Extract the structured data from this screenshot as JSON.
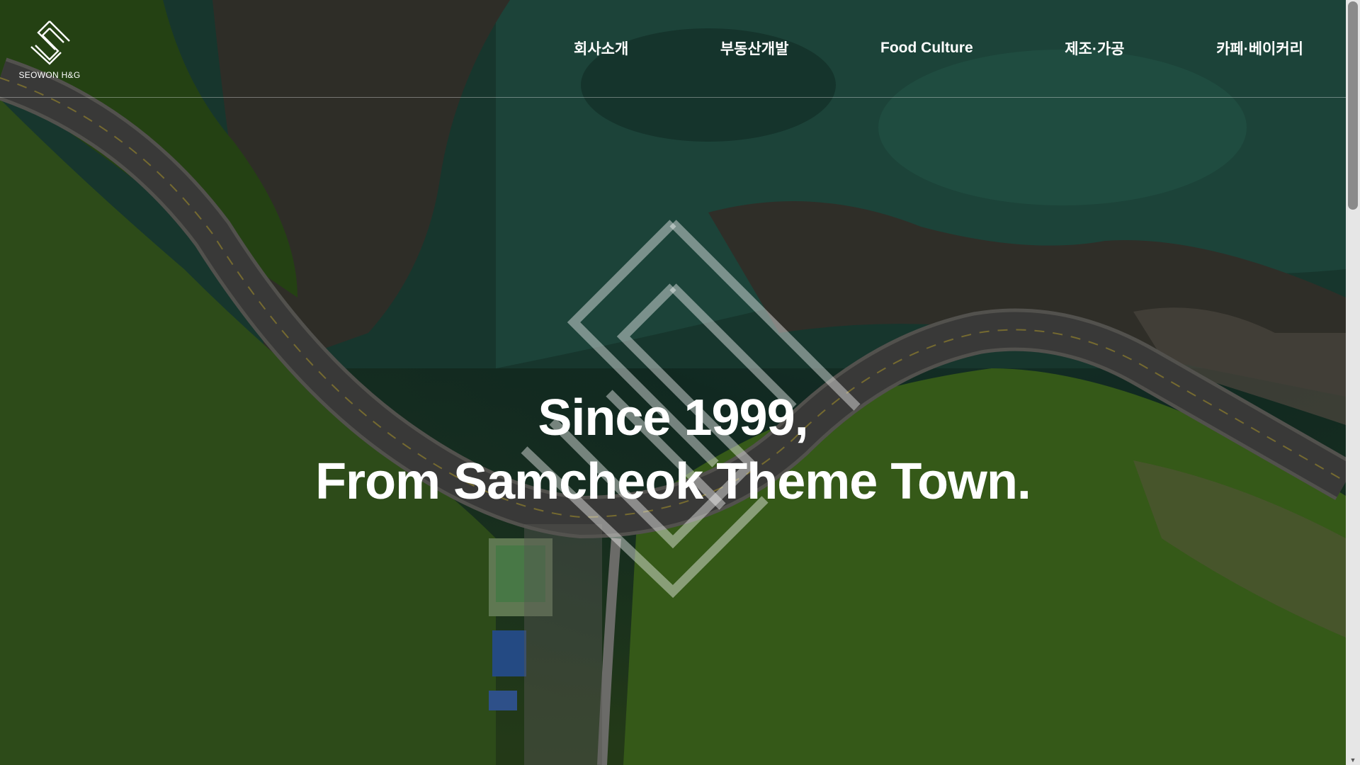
{
  "brand": {
    "name": "SEOWON H&G",
    "logo_icon": "seowon-diamond-logo-icon"
  },
  "nav": {
    "items": [
      {
        "label": "회사소개"
      },
      {
        "label": "부동산개발"
      },
      {
        "label": "Food Culture"
      },
      {
        "label": "제조·가공"
      },
      {
        "label": "카페·베이커리"
      }
    ]
  },
  "hero": {
    "line1": "Since 1999,",
    "line2": "From Samcheok Theme Town.",
    "emblem_icon": "seowon-diamond-emblem-icon"
  },
  "colors": {
    "text": "#ffffff",
    "sea": "#1f4a3c",
    "forest": "#3e6b22",
    "road": "#4a4a48"
  }
}
